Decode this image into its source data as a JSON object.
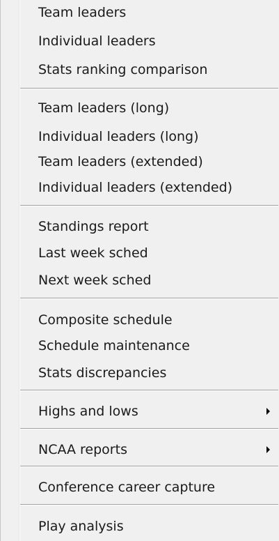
{
  "menu": {
    "items": [
      {
        "label": "Team leaders"
      },
      {
        "label": "Individual leaders"
      },
      {
        "label": "Stats ranking comparison"
      },
      {
        "label": "Team leaders (long)"
      },
      {
        "label": "Individual leaders (long)"
      },
      {
        "label": "Team leaders (extended)"
      },
      {
        "label": "Individual leaders (extended)"
      },
      {
        "label": "Standings report"
      },
      {
        "label": "Last week sched"
      },
      {
        "label": "Next week sched"
      },
      {
        "label": "Composite schedule"
      },
      {
        "label": "Schedule maintenance"
      },
      {
        "label": "Stats discrepancies"
      },
      {
        "label": "Highs and lows",
        "submenu_icon": "chevron-right-icon"
      },
      {
        "label": "NCAA reports",
        "submenu_icon": "chevron-right-icon"
      },
      {
        "label": "Conference career capture"
      },
      {
        "label": "Play analysis"
      }
    ]
  }
}
